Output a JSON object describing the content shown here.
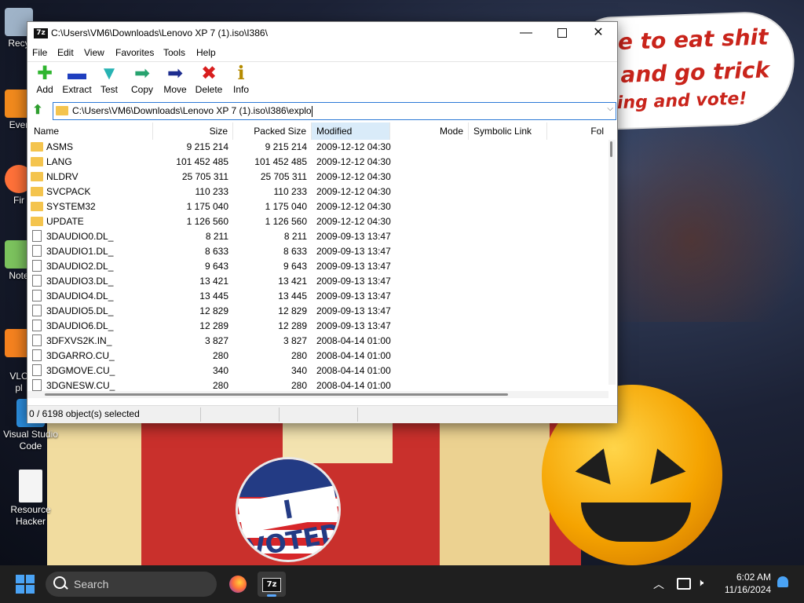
{
  "desktop": {
    "speech_lines": [
      "me to eat shit",
      "ie and go trick",
      "ting and vote!"
    ],
    "badge_text": "I VOTED",
    "icons": [
      {
        "name": "recycle-bin",
        "label": "Recy",
        "color": "#9fb3c8"
      },
      {
        "name": "everything",
        "label": "Ever",
        "color": "#f28a1d"
      },
      {
        "name": "firefox",
        "label": "Fir",
        "color": "#ff7139"
      },
      {
        "name": "notepad-plus",
        "label": "Note",
        "color": "#7cc35e"
      },
      {
        "name": "vlc",
        "label": "VLC\npl",
        "color": "#f5821f"
      },
      {
        "name": "vscode",
        "label": "Visual Studio Code",
        "color": "#2c8fe0"
      },
      {
        "name": "resource-hacker",
        "label": "Resource Hacker",
        "color": "#f4f4f4"
      }
    ]
  },
  "window": {
    "app_icon": "7z",
    "title": "C:\\Users\\VM6\\Downloads\\Lenovo XP 7 (1).iso\\I386\\",
    "menu": [
      "File",
      "Edit",
      "View",
      "Favorites",
      "Tools",
      "Help"
    ],
    "toolbar": [
      {
        "label": "Add",
        "icon": "plus-icon",
        "glyph": "✚",
        "color": "#2fb52f"
      },
      {
        "label": "Extract",
        "icon": "minus-icon",
        "glyph": "▬",
        "color": "#1f3fbf"
      },
      {
        "label": "Test",
        "icon": "check-icon",
        "glyph": "▼",
        "color": "#27b3b3"
      },
      {
        "label": "Copy",
        "icon": "copy-arrow-icon",
        "glyph": "➡",
        "color": "#27a36f"
      },
      {
        "label": "Move",
        "icon": "move-arrow-icon",
        "glyph": "➡",
        "color": "#1d2d8f"
      },
      {
        "label": "Delete",
        "icon": "delete-x-icon",
        "glyph": "✖",
        "color": "#d81e1e"
      },
      {
        "label": "Info",
        "icon": "info-icon",
        "glyph": "ℹ",
        "color": "#b58b00"
      }
    ],
    "address": "C:\\Users\\VM6\\Downloads\\Lenovo XP 7 (1).iso\\I386\\explo",
    "columns": [
      "Name",
      "Size",
      "Packed Size",
      "Modified",
      "Mode",
      "Symbolic Link",
      "Fol"
    ],
    "rows": [
      {
        "type": "folder",
        "name": "ASMS",
        "size": "9 215 214",
        "packed": "9 215 214",
        "modified": "2009-12-12 04:30"
      },
      {
        "type": "folder",
        "name": "LANG",
        "size": "101 452 485",
        "packed": "101 452 485",
        "modified": "2009-12-12 04:30"
      },
      {
        "type": "folder",
        "name": "NLDRV",
        "size": "25 705 311",
        "packed": "25 705 311",
        "modified": "2009-12-12 04:30"
      },
      {
        "type": "folder",
        "name": "SVCPACK",
        "size": "110 233",
        "packed": "110 233",
        "modified": "2009-12-12 04:30"
      },
      {
        "type": "folder",
        "name": "SYSTEM32",
        "size": "1 175 040",
        "packed": "1 175 040",
        "modified": "2009-12-12 04:30"
      },
      {
        "type": "folder",
        "name": "UPDATE",
        "size": "1 126 560",
        "packed": "1 126 560",
        "modified": "2009-12-12 04:30"
      },
      {
        "type": "file",
        "name": "3DAUDIO0.DL_",
        "size": "8 211",
        "packed": "8 211",
        "modified": "2009-09-13 13:47"
      },
      {
        "type": "file",
        "name": "3DAUDIO1.DL_",
        "size": "8 633",
        "packed": "8 633",
        "modified": "2009-09-13 13:47"
      },
      {
        "type": "file",
        "name": "3DAUDIO2.DL_",
        "size": "9 643",
        "packed": "9 643",
        "modified": "2009-09-13 13:47"
      },
      {
        "type": "file",
        "name": "3DAUDIO3.DL_",
        "size": "13 421",
        "packed": "13 421",
        "modified": "2009-09-13 13:47"
      },
      {
        "type": "file",
        "name": "3DAUDIO4.DL_",
        "size": "13 445",
        "packed": "13 445",
        "modified": "2009-09-13 13:47"
      },
      {
        "type": "file",
        "name": "3DAUDIO5.DL_",
        "size": "12 829",
        "packed": "12 829",
        "modified": "2009-09-13 13:47"
      },
      {
        "type": "file",
        "name": "3DAUDIO6.DL_",
        "size": "12 289",
        "packed": "12 289",
        "modified": "2009-09-13 13:47"
      },
      {
        "type": "file",
        "name": "3DFXVS2K.IN_",
        "size": "3 827",
        "packed": "3 827",
        "modified": "2008-04-14 01:00"
      },
      {
        "type": "file",
        "name": "3DGARRO.CU_",
        "size": "280",
        "packed": "280",
        "modified": "2008-04-14 01:00"
      },
      {
        "type": "file",
        "name": "3DGMOVE.CU_",
        "size": "340",
        "packed": "340",
        "modified": "2008-04-14 01:00"
      },
      {
        "type": "file",
        "name": "3DGNESW.CU_",
        "size": "280",
        "packed": "280",
        "modified": "2008-04-14 01:00"
      }
    ],
    "status": "0 / 6198 object(s) selected"
  },
  "taskbar": {
    "search_placeholder": "Search",
    "time": "6:02 AM",
    "date": "11/16/2024",
    "z7_icon": "7z"
  }
}
